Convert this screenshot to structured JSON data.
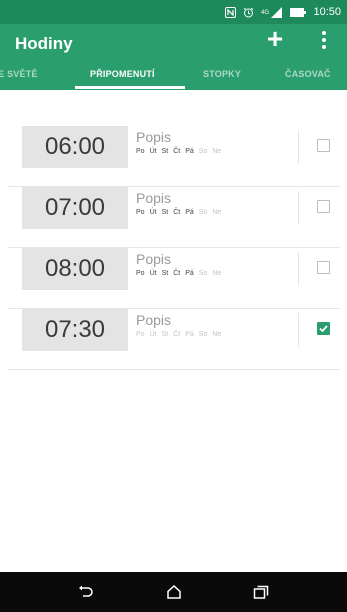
{
  "status_bar": {
    "time": "10:50",
    "icons": [
      "nfc-icon",
      "alarm-icon",
      "signal-icon",
      "battery-icon"
    ]
  },
  "app_bar": {
    "title": "Hodiny",
    "add_icon": "plus-icon",
    "menu_icon": "more-vert-icon"
  },
  "tabs": [
    {
      "label": "VE SVĚTĚ",
      "active": false
    },
    {
      "label": "PŘIPOMENUTÍ",
      "active": true
    },
    {
      "label": "STOPKY",
      "active": false
    },
    {
      "label": "ČASOVAČ",
      "active": false
    }
  ],
  "alarms": [
    {
      "time": "06:00",
      "title": "Popis",
      "days": [
        "Po",
        "Út",
        "St",
        "Čt",
        "Pá",
        "So",
        "Ne"
      ],
      "days_on": [
        true,
        true,
        true,
        true,
        true,
        false,
        false
      ],
      "enabled": false
    },
    {
      "time": "07:00",
      "title": "Popis",
      "days": [
        "Po",
        "Út",
        "St",
        "Čt",
        "Pá",
        "So",
        "Ne"
      ],
      "days_on": [
        true,
        true,
        true,
        true,
        true,
        false,
        false
      ],
      "enabled": false
    },
    {
      "time": "08:00",
      "title": "Popis",
      "days": [
        "Po",
        "Út",
        "St",
        "Čt",
        "Pá",
        "So",
        "Ne"
      ],
      "days_on": [
        true,
        true,
        true,
        true,
        true,
        false,
        false
      ],
      "enabled": false
    },
    {
      "time": "07:30",
      "title": "Popis",
      "days": [
        "Po",
        "Út",
        "St",
        "Čt",
        "Pá",
        "So",
        "Ne"
      ],
      "days_on": [
        true,
        true,
        true,
        true,
        true,
        false,
        false
      ],
      "enabled": true
    }
  ],
  "nav_bar": {
    "icons": [
      "back-icon",
      "home-icon",
      "recents-icon"
    ]
  },
  "colors": {
    "accent": "#2b9e6d",
    "status_bar": "#1e8a5b",
    "nav_bar": "#0a0a0a"
  }
}
